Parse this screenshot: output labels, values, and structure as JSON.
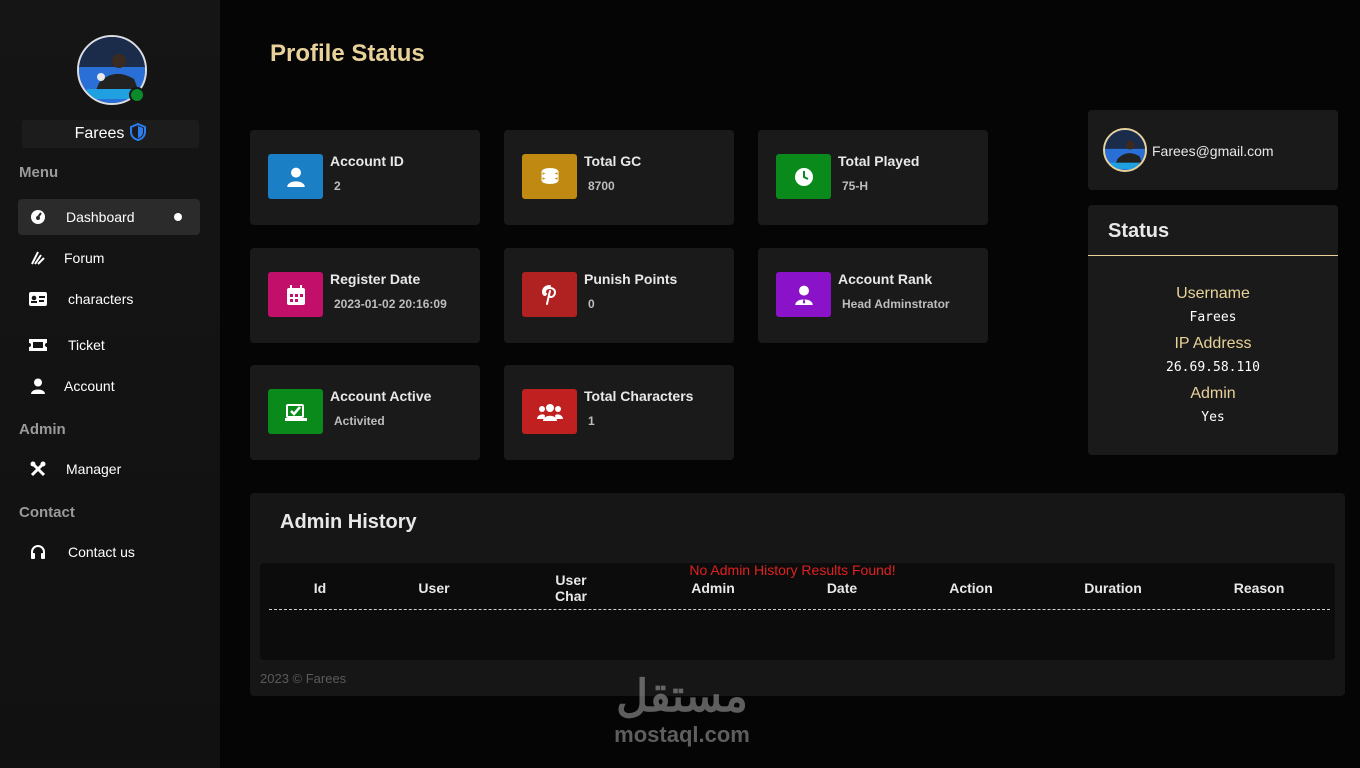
{
  "sidebar": {
    "user_name": "Farees",
    "sections": {
      "menu": "Menu",
      "admin": "Admin",
      "contact": "Contact"
    },
    "items": [
      {
        "label": "Dashboard",
        "icon": "dashboard-icon"
      },
      {
        "label": "Forum",
        "icon": "forum-icon"
      },
      {
        "label": "characters",
        "icon": "id-card-icon"
      },
      {
        "label": "Ticket",
        "icon": "ticket-icon"
      },
      {
        "label": "Account",
        "icon": "user-icon"
      },
      {
        "label": "Manager",
        "icon": "tools-icon"
      },
      {
        "label": "Contact us",
        "icon": "headset-icon"
      }
    ]
  },
  "main": {
    "title": "Profile Status",
    "cards": [
      {
        "label": "Account ID",
        "value": "2",
        "color": "#1a7fc4",
        "icon": "user-icon"
      },
      {
        "label": "Total GC",
        "value": "8700",
        "color": "#c08a12",
        "icon": "coins-icon"
      },
      {
        "label": "Total Played",
        "value": "75-H",
        "color": "#0a8a1a",
        "icon": "clock-icon"
      },
      {
        "label": "Register Date",
        "value": "2023-01-02 20:16:09",
        "color": "#c2106a",
        "icon": "calendar-icon"
      },
      {
        "label": "Punish Points",
        "value": "0",
        "color": "#b02222",
        "icon": "pinterest-icon"
      },
      {
        "label": "Account Rank",
        "value": "Head Adminstrator",
        "color": "#8a12c8",
        "icon": "admin-user-icon"
      },
      {
        "label": "Account Active",
        "value": "Activited",
        "color": "#0a8a1a",
        "icon": "check-box-icon"
      },
      {
        "label": "Total Characters",
        "value": "1",
        "color": "#c02020",
        "icon": "users-icon"
      }
    ]
  },
  "profile": {
    "email": "Farees@gmail.com",
    "status_title": "Status",
    "fields": [
      {
        "label": "Username",
        "value": "Farees"
      },
      {
        "label": "IP Address",
        "value": "26.69.58.110"
      },
      {
        "label": "Admin",
        "value": "Yes"
      }
    ]
  },
  "history": {
    "title": "Admin History",
    "columns": [
      "Id",
      "User",
      "User\nChar",
      "Admin",
      "Date",
      "Action",
      "Duration",
      "Reason"
    ],
    "empty_message": "No Admin History Results Found!",
    "footer": "2023 © Farees"
  },
  "watermark": {
    "arabic": "مستقل",
    "latin": "mostaql.com"
  }
}
